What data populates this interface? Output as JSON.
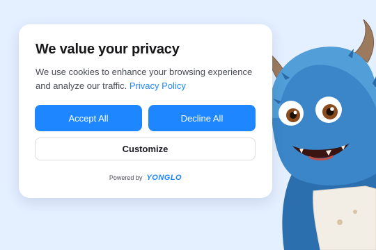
{
  "banner": {
    "title": "We value your privacy",
    "description": "We use cookies to enhance your browsing experience and analyze our traffic.",
    "policy_link": "Privacy Policy"
  },
  "buttons": {
    "accept": "Accept All",
    "decline": "Decline All",
    "customize": "Customize"
  },
  "footer": {
    "powered_by": "Powered by",
    "brand": "YONGLO"
  },
  "colors": {
    "accent": "#1e86ff",
    "page_background": "#e4efff",
    "card_background": "#ffffff",
    "mascot_fur": "#2f7fc1"
  },
  "icons": [
    "monster-mascot"
  ]
}
